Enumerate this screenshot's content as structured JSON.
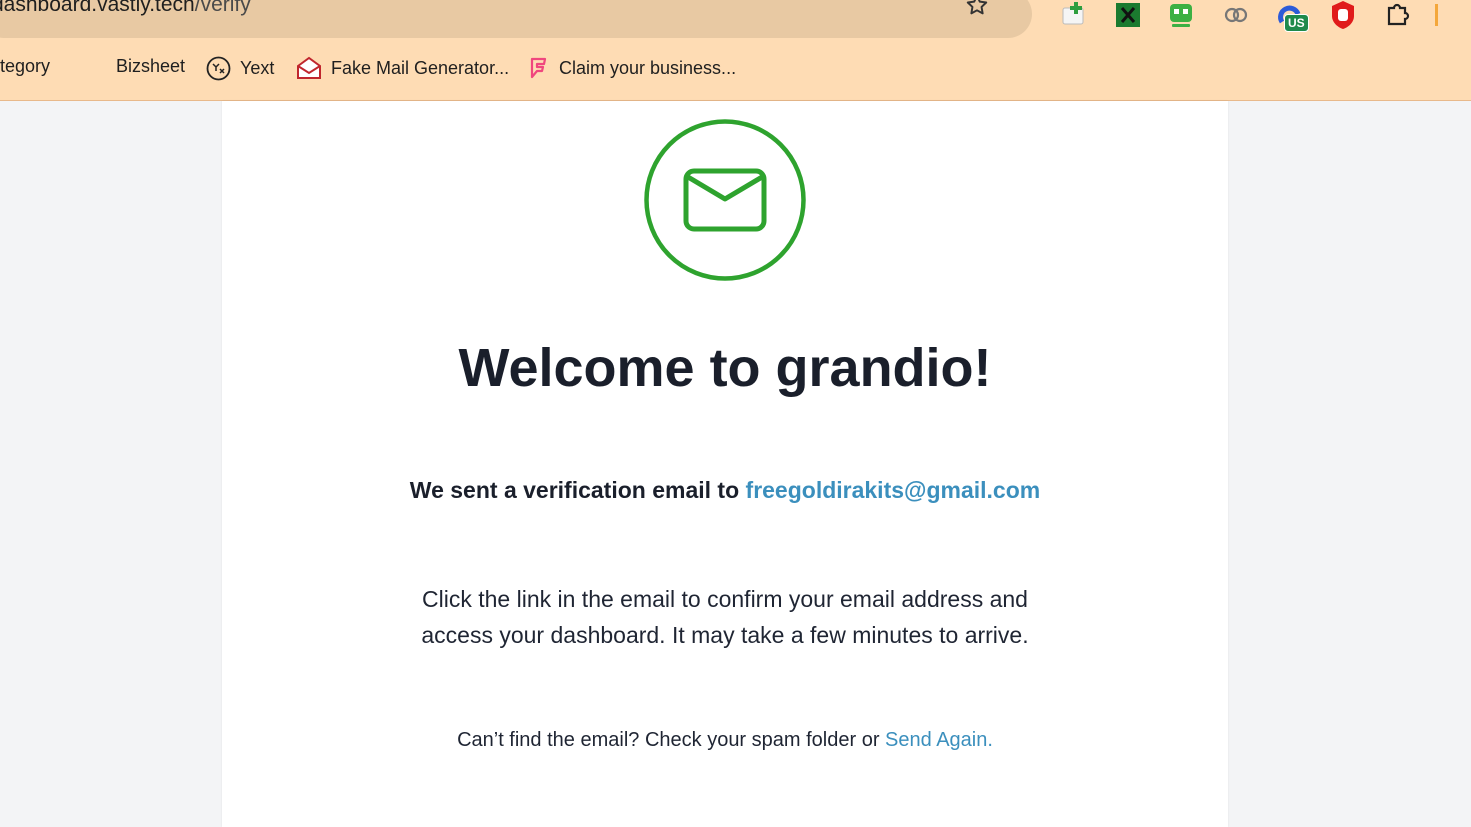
{
  "browser": {
    "url_host": "dashboard.vastly.tech",
    "url_path": "/verify",
    "bookmarks": [
      {
        "label": "tegory",
        "icon": "none"
      },
      {
        "label": "Bizsheet",
        "icon": "none"
      },
      {
        "label": "Yext",
        "icon": "yext-logo-icon"
      },
      {
        "label": "Fake Mail Generator...",
        "icon": "envelope-open-icon"
      },
      {
        "label": "Claim your business...",
        "icon": "foursquare-icon"
      }
    ],
    "extensions": [
      {
        "name": "add-note-extension-icon"
      },
      {
        "name": "green-x-extension-icon"
      },
      {
        "name": "robot-extension-icon"
      },
      {
        "name": "link-extension-icon"
      },
      {
        "name": "vpn-us-extension-icon",
        "badge": "US"
      },
      {
        "name": "adblock-hand-icon"
      },
      {
        "name": "puzzle-extensions-icon"
      }
    ]
  },
  "page": {
    "title": "Welcome to grandio!",
    "sent_prefix": "We sent a verification email to ",
    "email": "freegoldirakits@gmail.com",
    "instructions": "Click the link in the email to confirm your email address and access your dashboard. It may take a few minutes to arrive.",
    "spam_prefix": "Can’t find the email? Check your spam folder or ",
    "send_again": "Send Again."
  },
  "colors": {
    "accent_green": "#2ea32e",
    "link_blue": "#3b8fbd",
    "heading": "#1a1f2b",
    "chrome_bg": "#fedcb4"
  }
}
